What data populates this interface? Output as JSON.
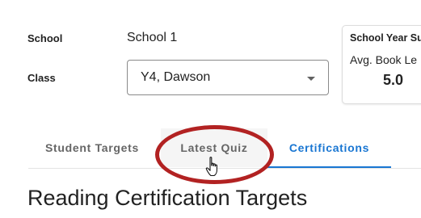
{
  "filters": {
    "school_label": "School",
    "school_value": "School 1",
    "class_label": "Class",
    "class_value": "Y4, Dawson"
  },
  "summary": {
    "title": "School Year Su",
    "metric_label": "Avg. Book Le",
    "metric_value": "5.0"
  },
  "tabs": [
    {
      "label": "Student Targets",
      "active": false
    },
    {
      "label": "Latest Quiz",
      "active": false,
      "hovered": true
    },
    {
      "label": "Certifications",
      "active": true
    }
  ],
  "section": {
    "heading": "Reading Certification Targets"
  },
  "colors": {
    "accent": "#1976d2",
    "highlight": "#b22222",
    "tab_text": "#666666"
  },
  "icons": {
    "dropdown": "chevron-down-icon",
    "cursor": "hand-pointer-cursor-icon"
  }
}
